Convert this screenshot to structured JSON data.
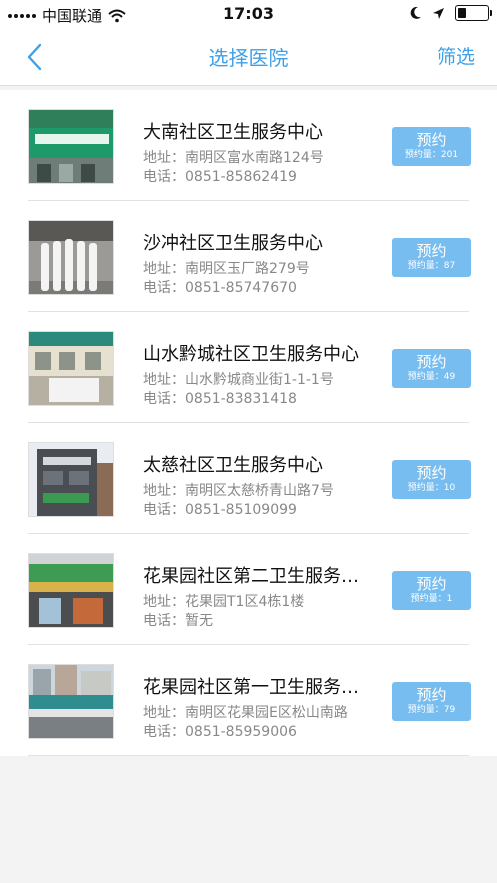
{
  "status_bar": {
    "carrier": "中国联通",
    "time": "17:03"
  },
  "nav": {
    "back_icon": "chevron-left-icon",
    "title": "选择医院",
    "filter_label": "筛选"
  },
  "hospitals": [
    {
      "name": "大南社区卫生服务中心",
      "address": "地址：南明区富水南路124号",
      "phone": "电话：0851-85862419",
      "book_label": "预约",
      "book_count": "预约量：201"
    },
    {
      "name": "沙冲社区卫生服务中心",
      "address": "地址：南明区玉厂路279号",
      "phone": "电话：0851-85747670",
      "book_label": "预约",
      "book_count": "预约量：87"
    },
    {
      "name": "山水黔城社区卫生服务中心",
      "address": "地址：山水黔城商业街1-1-1号",
      "phone": "电话：0851-83831418",
      "book_label": "预约",
      "book_count": "预约量：49"
    },
    {
      "name": "太慈社区卫生服务中心",
      "address": "地址：南明区太慈桥青山路7号",
      "phone": "电话：0851-85109099",
      "book_label": "预约",
      "book_count": "预约量：10"
    },
    {
      "name": "花果园社区第二卫生服务中心",
      "address": "地址：花果园T1区4栋1楼",
      "phone": "电话：暂无",
      "book_label": "预约",
      "book_count": "预约量：1"
    },
    {
      "name": "花果园社区第一卫生服务中心",
      "address": "地址：南明区花果园E区松山南路",
      "phone": "电话：0851-85959006",
      "book_label": "预约",
      "book_count": "预约量：79"
    }
  ],
  "colors": {
    "accent": "#3ea0e6",
    "button": "#78bdf0"
  }
}
